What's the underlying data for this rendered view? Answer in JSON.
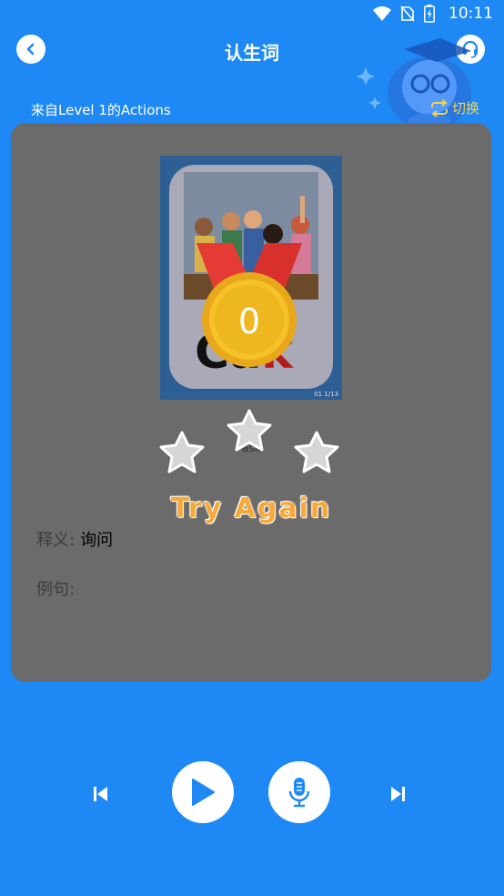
{
  "status": {
    "time": "10:11",
    "icons": [
      "wifi-icon",
      "no-sim-icon",
      "battery-icon"
    ]
  },
  "header": {
    "title": "认生词",
    "back_icon": "chevron-left-icon",
    "support_icon": "headset-icon"
  },
  "source": {
    "label": "来自Level 1的Actions",
    "switch_label": "切换"
  },
  "card": {
    "image_text_main": "Ca",
    "image_text_accent": "k",
    "image_caption": "01 1/13",
    "medal_score": "0",
    "stars_earned": 0,
    "stars_total": 3,
    "word_partial": "ask",
    "result_text": "Try Again",
    "meaning_label": "释义:",
    "meaning_value": "询问",
    "example_label": "例句:"
  },
  "controls": {
    "prev_icon": "skip-previous-icon",
    "play_icon": "play-icon",
    "mic_icon": "microphone-icon",
    "next_icon": "skip-next-icon"
  },
  "colors": {
    "background": "#1e88f5",
    "card_overlay": "#6b6b6b",
    "accent_yellow": "#f5d34a",
    "medal_gold": "#f0b81e",
    "ribbon_red": "#e53b35",
    "try_again": "#f6a93a"
  }
}
